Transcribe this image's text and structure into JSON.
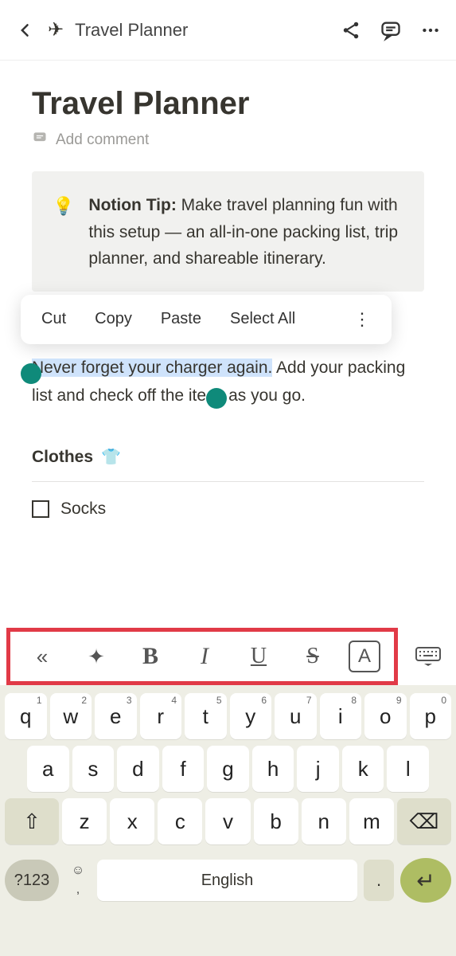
{
  "header": {
    "title": "Travel Planner",
    "icon": "✈"
  },
  "page": {
    "title": "Travel Planner",
    "add_comment": "Add comment",
    "callout": {
      "bulb": "💡",
      "bold": "Notion Tip:",
      "rest": " Make travel planning fun with this setup — an all-in-one packing list, trip planner, and shareable itinerary."
    },
    "body": {
      "hl": "Never forget your charger again.",
      "mid": " Add your packing list and check off the ite",
      "tail": "as you go."
    },
    "subhead": {
      "text": "Clothes",
      "emoji": "👕"
    },
    "todo1": "Socks"
  },
  "ctx": {
    "cut": "Cut",
    "copy": "Copy",
    "paste": "Paste",
    "selectall": "Select All"
  },
  "fmt": {
    "chev": "«",
    "sparkle": "✦",
    "b": "B",
    "i": "I",
    "u": "U",
    "s": "S",
    "a": "A"
  },
  "kb": {
    "row1": [
      [
        "q",
        "1"
      ],
      [
        "w",
        "2"
      ],
      [
        "e",
        "3"
      ],
      [
        "r",
        "4"
      ],
      [
        "t",
        "5"
      ],
      [
        "y",
        "6"
      ],
      [
        "u",
        "7"
      ],
      [
        "i",
        "8"
      ],
      [
        "o",
        "9"
      ],
      [
        "p",
        "0"
      ]
    ],
    "row2": [
      "a",
      "s",
      "d",
      "f",
      "g",
      "h",
      "j",
      "k",
      "l"
    ],
    "row3": [
      "z",
      "x",
      "c",
      "v",
      "b",
      "n",
      "m"
    ],
    "shift": "⇧",
    "bksp": "⌫",
    "n123": "?123",
    "emoji": "☺",
    "comma": ",",
    "space": "English",
    "dot": ".",
    "enter": "↵"
  }
}
